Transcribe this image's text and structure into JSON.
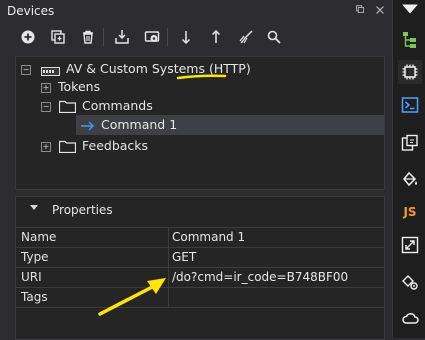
{
  "window": {
    "title": "Devices"
  },
  "toolbar": {
    "buttons": [
      {
        "icon": "add-icon"
      },
      {
        "icon": "copy-icon"
      },
      {
        "icon": "delete-icon"
      },
      {
        "icon": "import-icon"
      },
      {
        "icon": "device-settings-icon"
      },
      {
        "icon": "move-down-icon"
      },
      {
        "icon": "move-up-icon"
      },
      {
        "icon": "clean-icon"
      },
      {
        "icon": "search-icon"
      }
    ]
  },
  "tree": {
    "root_label": "AV & Custom Systems (HTTP)",
    "tokens_label": "Tokens",
    "commands_label": "Commands",
    "command1_label": "Command 1",
    "feedbacks_label": "Feedbacks"
  },
  "properties": {
    "title": "Properties",
    "rows": [
      {
        "key": "Name",
        "value": "Command 1"
      },
      {
        "key": "Type",
        "value": "GET"
      },
      {
        "key": "URI",
        "value": "/do?cmd=ir_code=B748BF00"
      },
      {
        "key": "Tags",
        "value": ""
      }
    ]
  },
  "rightbar": {
    "js_label": "JS"
  },
  "colors": {
    "accent_yellow": "#ffe600",
    "arrow_blue": "#3d9bff",
    "green_icon": "#7ec850",
    "orange_js": "#f59a23"
  }
}
